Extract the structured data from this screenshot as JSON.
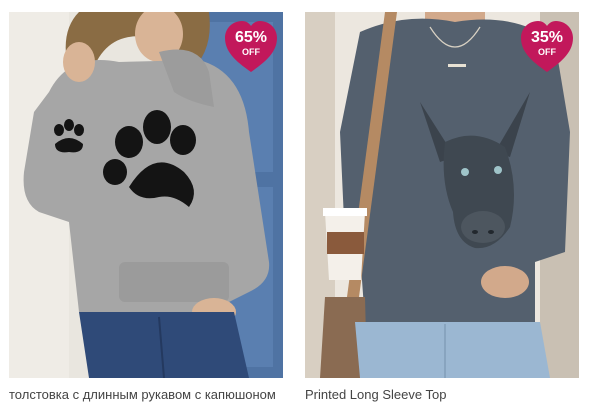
{
  "products": [
    {
      "title": "толстовка с длинным рукавом с капюшоном",
      "discount": "65%",
      "discount_suffix": "OFF",
      "image": "grey-hoodie-paw-print-icon"
    },
    {
      "title": "Printed Long Sleeve Top",
      "discount": "35%",
      "discount_suffix": "OFF",
      "image": "grey-top-donkey-print-icon"
    }
  ],
  "colors": {
    "badge": "#c2185b",
    "title_text": "#444444"
  }
}
